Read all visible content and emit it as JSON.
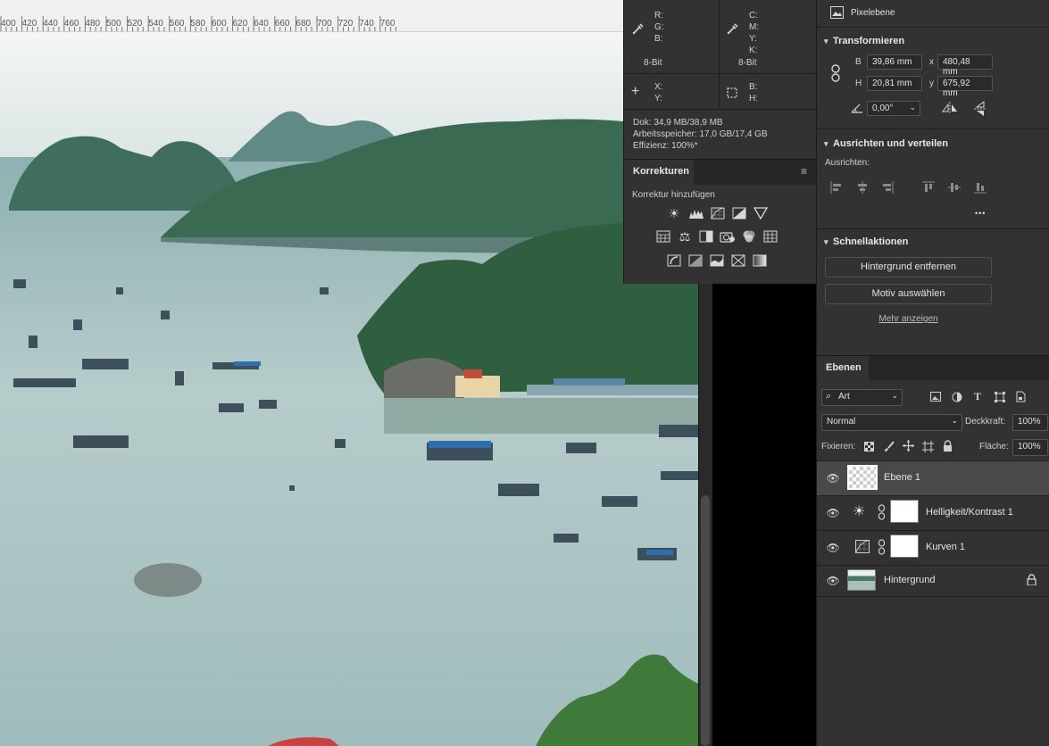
{
  "ruler": {
    "labels": [
      "400",
      "420",
      "440",
      "460",
      "480",
      "500",
      "520",
      "540",
      "560",
      "580",
      "600",
      "620",
      "640",
      "660",
      "680",
      "700",
      "720",
      "740",
      "760"
    ]
  },
  "info": {
    "rgb_labels": {
      "r": "R:",
      "g": "G:",
      "b": "B:"
    },
    "cmyk_labels": {
      "c": "C:",
      "m": "M:",
      "y": "Y:",
      "k": "K:"
    },
    "bit_left": "8-Bit",
    "bit_right": "8-Bit",
    "xy_labels": {
      "x": "X:",
      "y": "Y:"
    },
    "bh_labels": {
      "b": "B:",
      "h": "H:"
    },
    "doc": "Dok: 34,9 MB/38,9 MB",
    "memory": "Arbeitsspeicher: 17,0 GB/17,4 GB",
    "efficiency": "Effizienz: 100%*"
  },
  "korrekturen": {
    "tab_label": "Korrekturen",
    "subtitle": "Korrektur hinzufügen"
  },
  "properties": {
    "layer_kind": "Pixelebene",
    "transform": {
      "title": "Transformieren",
      "b_label": "B",
      "b_value": "39,86 mm",
      "x_label": "x",
      "x_value": "480,48 mm",
      "h_label": "H",
      "h_value": "20,81 mm",
      "y_label": "y",
      "y_value": "675,92 mm",
      "angle_value": "0,00°"
    },
    "align": {
      "title": "Ausrichten und verteilen",
      "subtitle": "Ausrichten:",
      "more": "•••"
    },
    "quick": {
      "title": "Schnellaktionen",
      "remove_bg": "Hintergrund entfernen",
      "select_subject": "Motiv auswählen",
      "show_more": "Mehr anzeigen"
    }
  },
  "layers": {
    "tab_label": "Ebenen",
    "filter_kind": "Art",
    "blend_mode": "Normal",
    "opacity_label": "Deckkraft:",
    "opacity_value": "100%",
    "lock_label": "Fixieren:",
    "fill_label": "Fläche:",
    "fill_value": "100%",
    "items": [
      {
        "name": "Ebene 1",
        "selected": true
      },
      {
        "name": "Helligkeit/Kontrast 1",
        "selected": false
      },
      {
        "name": "Kurven 1",
        "selected": false
      },
      {
        "name": "Hintergrund",
        "selected": false
      }
    ]
  }
}
